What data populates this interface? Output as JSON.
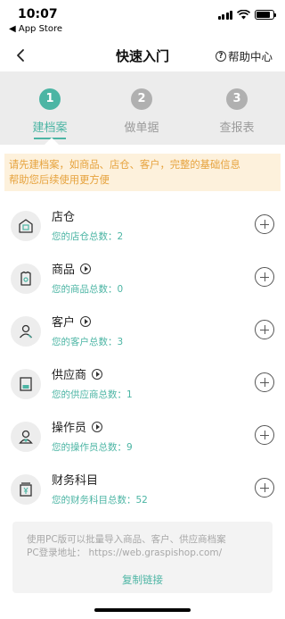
{
  "status_bar": {
    "time": "10:07",
    "back_app": "◀ App Store",
    "battery_level": 0.85
  },
  "nav": {
    "title": "快速入门",
    "help_label": "帮助中心",
    "help_icon_glyph": "?"
  },
  "steps": [
    {
      "number": "1",
      "label": "建档案",
      "active": true
    },
    {
      "number": "2",
      "label": "做单据",
      "active": false
    },
    {
      "number": "3",
      "label": "查报表",
      "active": false
    }
  ],
  "notice": {
    "line1": "请先建档案，如商品、店仓、客户，完整的基础信息",
    "line2": "帮助您后续使用更方便"
  },
  "items": [
    {
      "title": "店仓",
      "subtitle": "您的店仓总数：2",
      "icon": "store-icon",
      "has_video": false
    },
    {
      "title": "商品",
      "subtitle": "您的商品总数：0",
      "icon": "product-icon",
      "has_video": true
    },
    {
      "title": "客户",
      "subtitle": "您的客户总数：3",
      "icon": "customer-icon",
      "has_video": true
    },
    {
      "title": "供应商",
      "subtitle": "您的供应商总数：1",
      "icon": "supplier-icon",
      "has_video": true
    },
    {
      "title": "操作员",
      "subtitle": "您的操作员总数：9",
      "icon": "operator-icon",
      "has_video": true
    },
    {
      "title": "财务科目",
      "subtitle": "您的财务科目总数：52",
      "icon": "finance-icon",
      "has_video": false
    }
  ],
  "footer": {
    "line1": "使用PC版可以批量导入商品、客户、供应商档案",
    "line2": "PC登录地址：  https://web.graspishop.com/",
    "copy_label": "复制链接"
  },
  "colors": {
    "accent": "#4cb5a4",
    "notice_bg": "#fdf1dc",
    "notice_text": "#e6a23c"
  }
}
